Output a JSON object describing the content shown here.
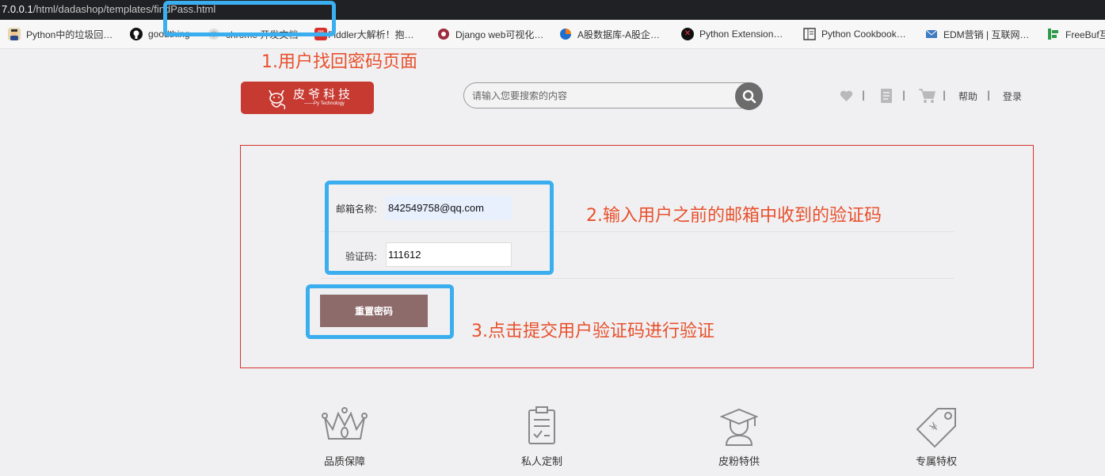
{
  "browser": {
    "url_host": "7.0.0.1",
    "url_path": "/html/dadashop/templates/findPass.html",
    "bookmarks": [
      {
        "label": "Python中的垃圾回…",
        "icon": "avatar-icon"
      },
      {
        "label": "goodthing",
        "icon": "github-icon"
      },
      {
        "label": "chrome 开发文档",
        "icon": "chrome-icon"
      },
      {
        "label": "Fiddler大解析！抱…",
        "icon": "page-icon"
      },
      {
        "label": "Django web可视化…",
        "icon": "django-icon"
      },
      {
        "label": "A股数据库-A股企…",
        "icon": "chart-icon"
      },
      {
        "label": "Python Extension…",
        "icon": "extension-icon"
      },
      {
        "label": "Python Cookbook…",
        "icon": "book-icon"
      },
      {
        "label": "EDM营销 | 互联网…",
        "icon": "mail-icon"
      },
      {
        "label": "FreeBuf互",
        "icon": "freebuf-icon"
      }
    ]
  },
  "annotations": {
    "step1": "1.用户找回密码页面",
    "step2": "2.输入用户之前的邮箱中收到的验证码",
    "step3": "3.点击提交用户验证码进行验证",
    "highlight_color": "#3baeef",
    "text_color": "#e8502c"
  },
  "header": {
    "logo_cn": "皮爷科技",
    "logo_en": "——Py Technology",
    "search_placeholder": "请输入您要搜索的内容",
    "nav": {
      "help": "帮助",
      "login": "登录",
      "separator": "|"
    }
  },
  "form": {
    "email_label": "邮箱名称:",
    "email_value": "842549758@qq.com",
    "code_label": "验证码:",
    "code_value": "111612",
    "submit_label": "重置密码",
    "border_color": "#d7322d",
    "button_color": "#8e6b6b"
  },
  "features": [
    {
      "label": "品质保障",
      "icon": "crown-icon"
    },
    {
      "label": "私人定制",
      "icon": "clipboard-icon"
    },
    {
      "label": "皮粉特供",
      "icon": "graduate-icon"
    },
    {
      "label": "专属特权",
      "icon": "price-tag-icon"
    }
  ]
}
